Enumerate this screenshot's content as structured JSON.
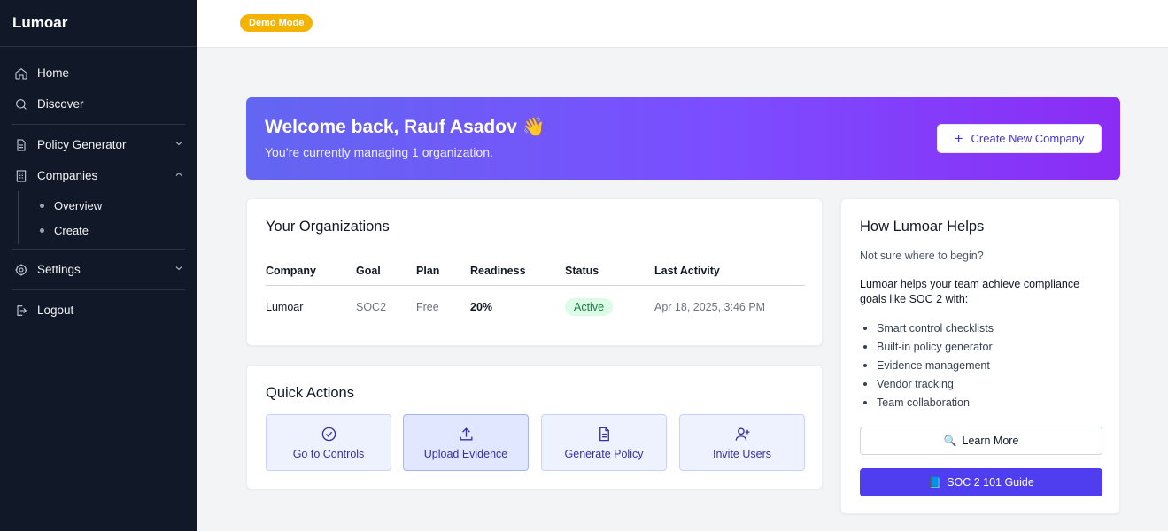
{
  "brand": "Lumoar",
  "topbar": {
    "demo_badge": "Demo Mode"
  },
  "sidebar": {
    "items": [
      {
        "label": "Home",
        "icon": "home-icon"
      },
      {
        "label": "Discover",
        "icon": "search-icon"
      },
      {
        "label": "Policy Generator",
        "icon": "document-icon"
      },
      {
        "label": "Companies",
        "icon": "building-icon"
      },
      {
        "label": "Settings",
        "icon": "gear-icon"
      },
      {
        "label": "Logout",
        "icon": "logout-icon"
      }
    ],
    "companies_sub": [
      "Overview",
      "Create"
    ]
  },
  "banner": {
    "title": "Welcome back, Rauf Asadov",
    "emoji": "👋",
    "subtitle": "You’re currently managing 1 organization.",
    "create_button": "Create New Company"
  },
  "organizations": {
    "title": "Your Organizations",
    "columns": [
      "Company",
      "Goal",
      "Plan",
      "Readiness",
      "Status",
      "Last Activity"
    ],
    "rows": [
      {
        "company": "Lumoar",
        "goal": "SOC2",
        "plan": "Free",
        "readiness": "20%",
        "status": "Active",
        "last_activity": "Apr 18, 2025, 3:46 PM"
      }
    ]
  },
  "quick_actions": {
    "title": "Quick Actions",
    "buttons": [
      {
        "label": "Go to Controls",
        "icon": "check-circle-icon"
      },
      {
        "label": "Upload Evidence",
        "icon": "upload-icon"
      },
      {
        "label": "Generate Policy",
        "icon": "file-text-icon"
      },
      {
        "label": "Invite Users",
        "icon": "user-plus-icon"
      }
    ]
  },
  "helps": {
    "title": "How Lumoar Helps",
    "lead": "Not sure where to begin?",
    "paragraph": "Lumoar helps your team achieve compliance goals like SOC 2 with:",
    "features": [
      "Smart control checklists",
      "Built-in policy generator",
      "Evidence management",
      "Vendor tracking",
      "Team collaboration"
    ],
    "learn_more": "Learn More",
    "learn_more_icon": "🔍",
    "guide": "SOC 2 101 Guide",
    "guide_icon": "📘"
  },
  "colors": {
    "accent": "#4f3df0",
    "sidebar_bg": "#111827",
    "badge": "#f5b301",
    "status_active_bg": "#dcfce7"
  }
}
